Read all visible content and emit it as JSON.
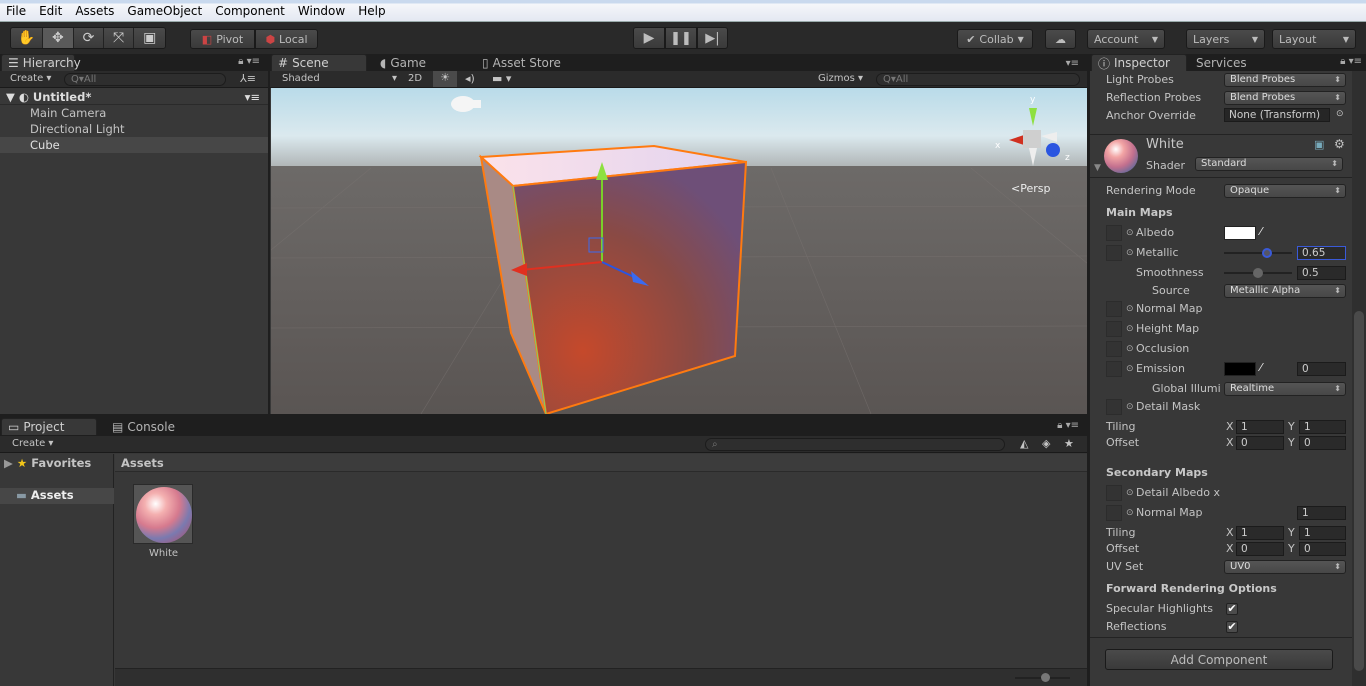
{
  "menu": [
    "File",
    "Edit",
    "Assets",
    "GameObject",
    "Component",
    "Window",
    "Help"
  ],
  "toolbar": {
    "tools": [
      "hand-icon",
      "move-icon",
      "rotate-icon",
      "scale-icon",
      "rect-icon"
    ],
    "pivot": "Pivot",
    "local": "Local",
    "collab": "Collab",
    "account": "Account",
    "layers": "Layers",
    "layout": "Layout"
  },
  "hierarchy": {
    "tab": "Hierarchy",
    "create": "Create",
    "search": "Q▾All",
    "scene": "Untitled*",
    "items": [
      "Main Camera",
      "Directional Light",
      "Cube"
    ],
    "selected": "Cube"
  },
  "scene": {
    "tabs": [
      "Scene",
      "Game",
      "Asset Store"
    ],
    "shading": "Shaded",
    "mode2d": "2D",
    "gizmos": "Gizmos",
    "search": "Q▾All",
    "persp": "<Persp",
    "axes": {
      "x": "x",
      "y": "y",
      "z": "z"
    }
  },
  "inspector": {
    "tabs": [
      "Inspector",
      "Services"
    ],
    "renderer": [
      {
        "label": "Light Probes",
        "value": "Blend Probes"
      },
      {
        "label": "Reflection Probes",
        "value": "Blend Probes"
      },
      {
        "label": "Anchor Override",
        "value": "None (Transform)"
      }
    ],
    "material": {
      "name": "White",
      "shader_label": "Shader",
      "shader": "Standard"
    },
    "rendering_mode_label": "Rendering Mode",
    "rendering_mode": "Opaque",
    "main_maps": "Main Maps",
    "albedo": "Albedo",
    "albedo_color": "#ffffff",
    "metallic": "Metallic",
    "metallic_value": "0.65",
    "smoothness": "Smoothness",
    "smoothness_value": "0.5",
    "source": "Source",
    "source_value": "Metallic Alpha",
    "normal_map": "Normal Map",
    "height_map": "Height Map",
    "occlusion": "Occlusion",
    "emission": "Emission",
    "emission_color": "#000000",
    "emission_value": "0",
    "gi_label": "Global Illumi",
    "gi_value": "Realtime",
    "detail_mask": "Detail Mask",
    "tiling": "Tiling",
    "offset": "Offset",
    "x": "X",
    "y": "Y",
    "main_tiling": [
      "1",
      "1"
    ],
    "main_offset": [
      "0",
      "0"
    ],
    "secondary_maps": "Secondary Maps",
    "detail_albedo": "Detail Albedo x",
    "sec_normal": "Normal Map",
    "sec_normal_value": "1",
    "sec_tiling": [
      "1",
      "1"
    ],
    "sec_offset": [
      "0",
      "0"
    ],
    "uv_set_label": "UV Set",
    "uv_set": "UV0",
    "forward": "Forward Rendering Options",
    "specular": "Specular Highlights",
    "reflections": "Reflections",
    "add_component": "Add Component"
  },
  "project": {
    "tabs": [
      "Project",
      "Console"
    ],
    "create": "Create",
    "favorites": "Favorites",
    "assets_folder": "Assets",
    "breadcrumb": "Assets",
    "items": [
      {
        "name": "White"
      }
    ]
  }
}
